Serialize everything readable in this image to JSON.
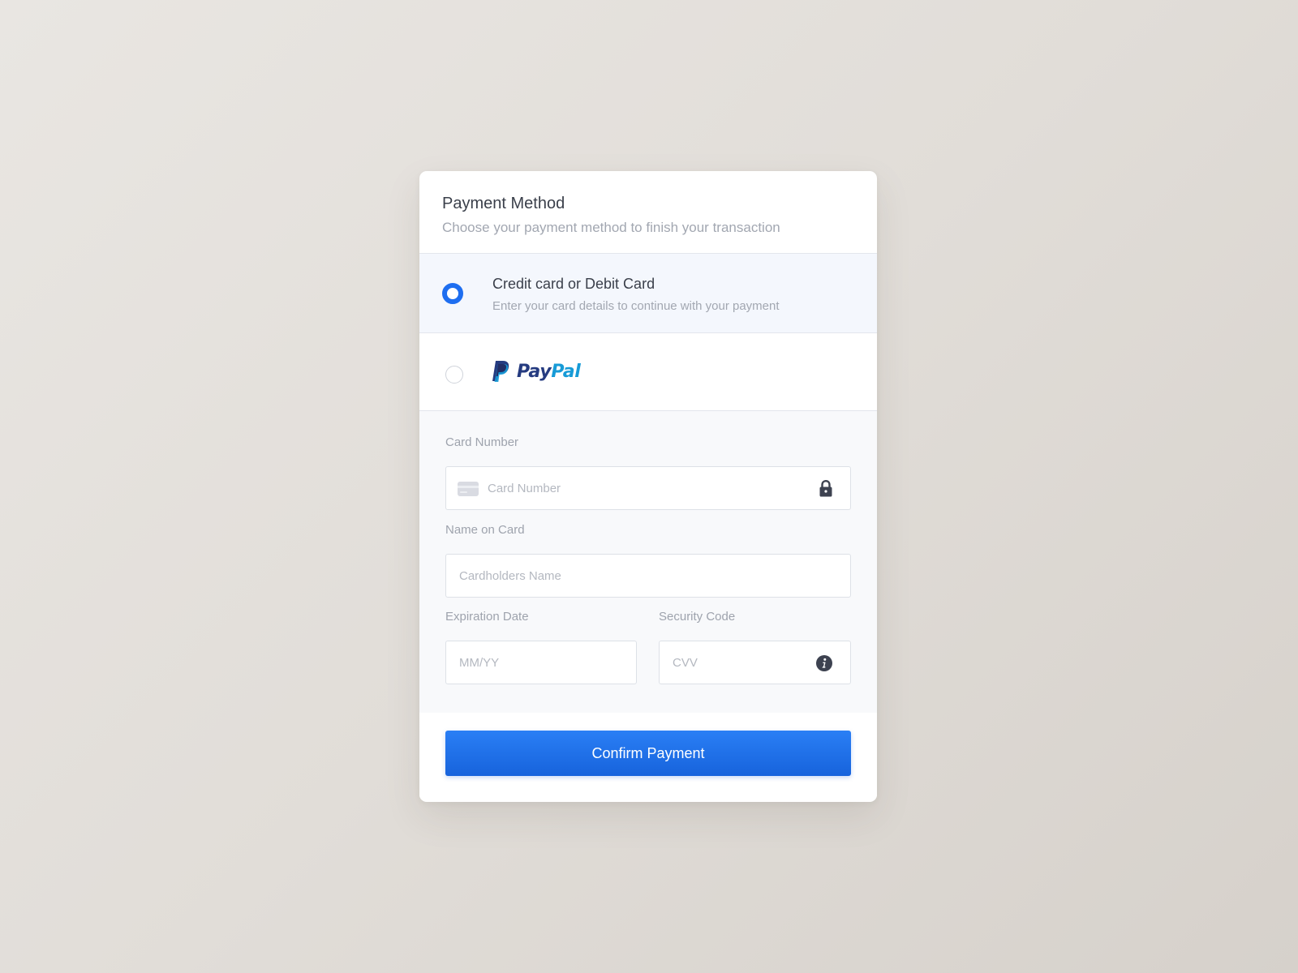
{
  "header": {
    "title": "Payment Method",
    "subtitle": "Choose your payment method to finish your transaction"
  },
  "options": [
    {
      "title": "Credit card or Debit Card",
      "description": "Enter your card details to continue with your payment",
      "selected": true
    },
    {
      "brand_pay": "Pay",
      "brand_pal": "Pal",
      "selected": false
    }
  ],
  "form": {
    "card_number": {
      "label": "Card Number",
      "placeholder": "Card Number",
      "value": ""
    },
    "name_on_card": {
      "label": "Name on Card",
      "placeholder": "Cardholders Name",
      "value": ""
    },
    "expiration": {
      "label": "Expiration Date",
      "placeholder": "MM/YY",
      "value": ""
    },
    "security": {
      "label": "Security Code",
      "placeholder": "CVV",
      "value": ""
    }
  },
  "confirm_label": "Confirm Payment",
  "icons": {
    "card_icon": "credit-card-icon",
    "lock_icon": "lock-icon",
    "info_icon": "info-icon",
    "paypal_icon": "paypal-logo"
  },
  "colors": {
    "accent": "#1e6ef0",
    "paypal_dark": "#253b80",
    "paypal_light": "#179bd7"
  }
}
